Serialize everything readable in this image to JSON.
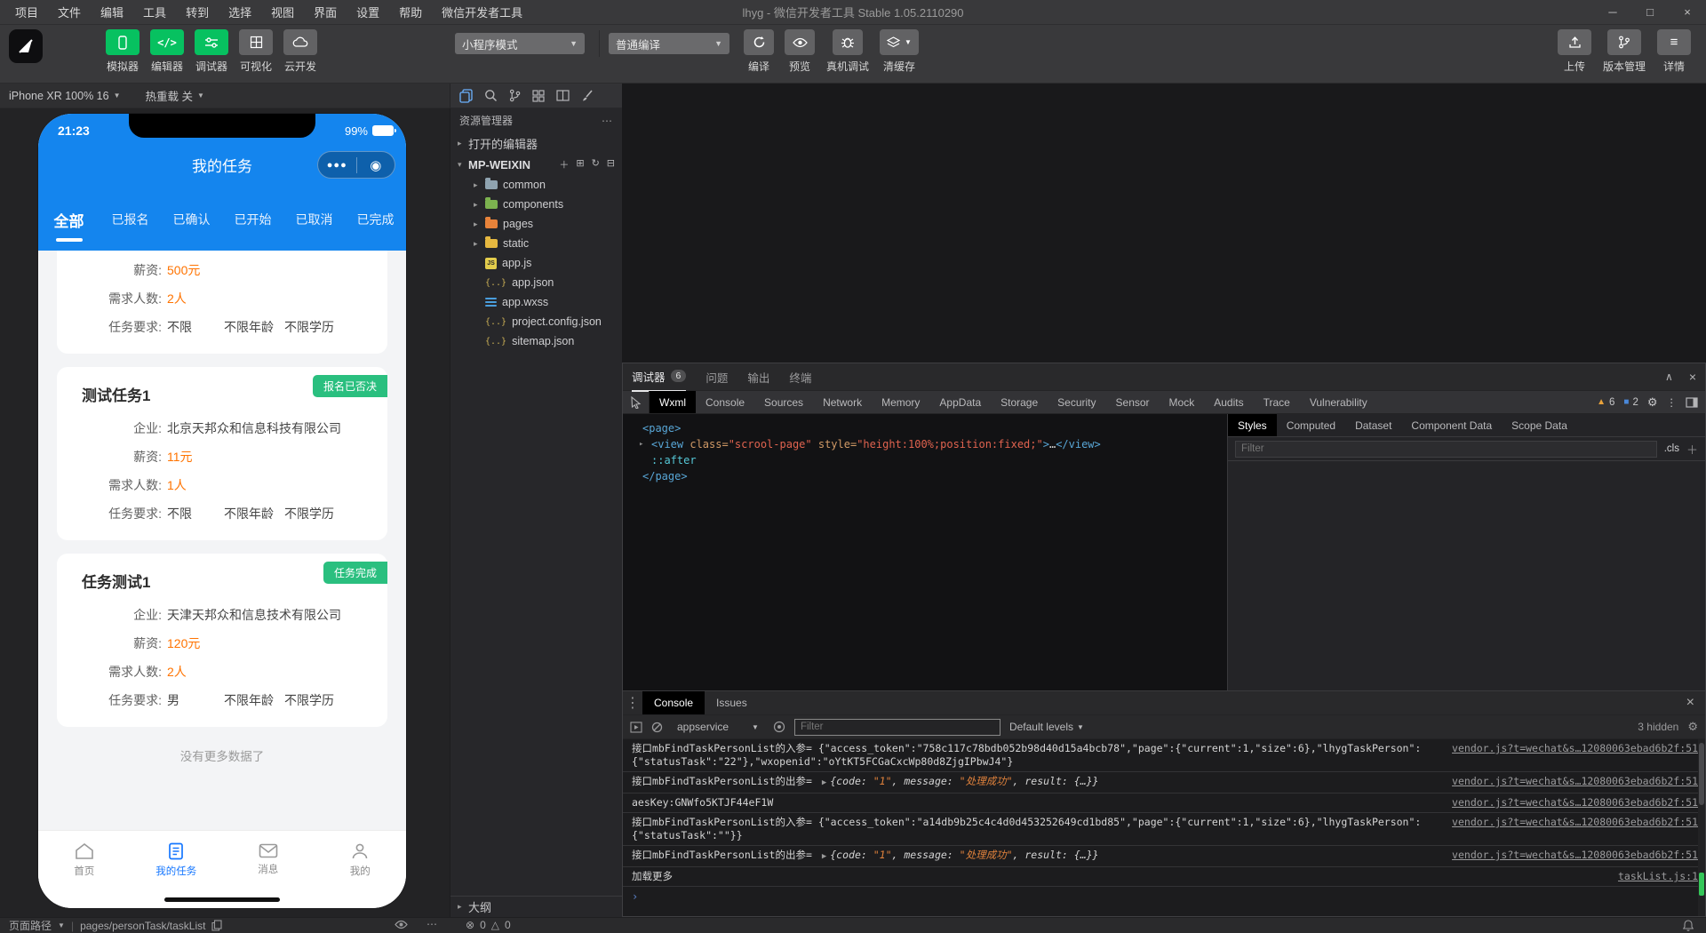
{
  "colors": {
    "brand_green": "#07c160",
    "phone_blue": "#1485ee",
    "highlight_orange": "#ff7300",
    "badge_green": "#2abf7f",
    "tab_active_blue": "#1677ff",
    "warning_yellow": "#e9a23b",
    "info_blue": "#4a88d9"
  },
  "titlebar": {
    "menus": [
      "项目",
      "文件",
      "编辑",
      "工具",
      "转到",
      "选择",
      "视图",
      "界面",
      "设置",
      "帮助",
      "微信开发者工具"
    ],
    "title": "lhyg - 微信开发者工具 Stable 1.05.2110290"
  },
  "toolbar": {
    "left_buttons": [
      {
        "label": "模拟器"
      },
      {
        "label": "编辑器"
      },
      {
        "label": "调试器"
      },
      {
        "label": "可视化"
      },
      {
        "label": "云开发"
      }
    ],
    "mode_select": "小程序模式",
    "compile_select": "普通编译",
    "action_buttons": [
      {
        "label": "编译"
      },
      {
        "label": "预览"
      },
      {
        "label": "真机调试"
      },
      {
        "label": "清缓存"
      }
    ],
    "right_buttons": [
      {
        "label": "上传"
      },
      {
        "label": "版本管理"
      },
      {
        "label": "详情"
      }
    ]
  },
  "simulator_bar": {
    "device": "iPhone XR 100% 16",
    "hot_reload": "热重载 关"
  },
  "phone": {
    "status": {
      "time": "21:23",
      "battery": "99%"
    },
    "nav_title": "我的任务",
    "tabs": [
      {
        "label": "全部",
        "active": true
      },
      {
        "label": "已报名"
      },
      {
        "label": "已确认"
      },
      {
        "label": "已开始"
      },
      {
        "label": "已取消"
      },
      {
        "label": "已完成"
      }
    ],
    "cards": [
      {
        "badge": null,
        "title": null,
        "rows": [
          {
            "label": "薪资:",
            "value": "500元",
            "hl": true
          },
          {
            "label": "需求人数:",
            "value": "2人",
            "hl": true
          },
          {
            "label": "任务要求:",
            "value": "不限",
            "extras": [
              "不限年龄",
              "不限学历"
            ]
          }
        ]
      },
      {
        "badge": "报名已否决",
        "title": "测试任务1",
        "rows": [
          {
            "label": "企业:",
            "value": "北京天邦众和信息科技有限公司"
          },
          {
            "label": "薪资:",
            "value": "11元",
            "hl": true
          },
          {
            "label": "需求人数:",
            "value": "1人",
            "hl": true
          },
          {
            "label": "任务要求:",
            "value": "不限",
            "extras": [
              "不限年龄",
              "不限学历"
            ]
          }
        ]
      },
      {
        "badge": "任务完成",
        "title": "任务测试1",
        "rows": [
          {
            "label": "企业:",
            "value": "天津天邦众和信息技术有限公司"
          },
          {
            "label": "薪资:",
            "value": "120元",
            "hl": true
          },
          {
            "label": "需求人数:",
            "value": "2人",
            "hl": true
          },
          {
            "label": "任务要求:",
            "value": "男",
            "extras": [
              "不限年龄",
              "不限学历"
            ]
          }
        ]
      }
    ],
    "empty_text": "没有更多数据了",
    "tabbar": [
      {
        "label": "首页"
      },
      {
        "label": "我的任务",
        "active": true
      },
      {
        "label": "消息"
      },
      {
        "label": "我的"
      }
    ]
  },
  "explorer": {
    "header": "资源管理器",
    "open_editors": "打开的编辑器",
    "project": "MP-WEIXIN",
    "tree": [
      {
        "name": "common",
        "icon": "folder",
        "color": "#8fa3b0"
      },
      {
        "name": "components",
        "icon": "folder",
        "color": "#7cb24f"
      },
      {
        "name": "pages",
        "icon": "folder",
        "color": "#e8833a"
      },
      {
        "name": "static",
        "icon": "folder",
        "color": "#e6b840"
      },
      {
        "name": "app.js",
        "icon": "js"
      },
      {
        "name": "app.json",
        "icon": "braces"
      },
      {
        "name": "app.wxss",
        "icon": "wxss"
      },
      {
        "name": "project.config.json",
        "icon": "braces"
      },
      {
        "name": "sitemap.json",
        "icon": "braces"
      }
    ],
    "outline": "大纲"
  },
  "debugger": {
    "panel_tabs": [
      {
        "label": "调试器",
        "badge": "6",
        "active": true
      },
      {
        "label": "问题"
      },
      {
        "label": "输出"
      },
      {
        "label": "终端"
      }
    ],
    "devtools_tabs": [
      "Wxml",
      "Console",
      "Sources",
      "Network",
      "Memory",
      "AppData",
      "Storage",
      "Security",
      "Sensor",
      "Mock",
      "Audits",
      "Trace",
      "Vulnerability"
    ],
    "active_devtools_tab": "Wxml",
    "warn_count": "6",
    "info_count": "2",
    "code_lines": [
      {
        "indent": 0,
        "parts": [
          [
            "tag",
            "<page>"
          ]
        ]
      },
      {
        "indent": 1,
        "arrow": true,
        "parts": [
          [
            "tag",
            "<view"
          ],
          [
            "attr",
            " class="
          ],
          [
            "str",
            "\"scrool-page\""
          ],
          [
            "attr",
            " style="
          ],
          [
            "str",
            "\"height:100%;position:fixed;\""
          ],
          [
            "tag",
            ">"
          ],
          [
            "t",
            "…"
          ],
          [
            "tag",
            "</view>"
          ]
        ]
      },
      {
        "indent": 1,
        "parts": [
          [
            "pseudo",
            "::after"
          ]
        ]
      },
      {
        "indent": 0,
        "parts": [
          [
            "tag",
            "</page>"
          ]
        ]
      }
    ],
    "styles_tabs": [
      "Styles",
      "Computed",
      "Dataset",
      "Component Data",
      "Scope Data"
    ],
    "active_styles_tab": "Styles",
    "filter_placeholder": "Filter",
    "cls_label": ".cls"
  },
  "console": {
    "tabs": [
      "Console",
      "Issues"
    ],
    "active_tab": "Console",
    "context": "appservice",
    "filter_placeholder": "Filter",
    "levels": "Default levels",
    "hidden": "3 hidden",
    "logs": [
      {
        "parts": [
          [
            "t",
            "接口mbFindTaskPersonList的入参= {\"access_token\":\"758c117c78bdb052b98d40d15a4bcb78\",\"page\":{\"current\":1,\"size\":6},\"lhygTaskPerson\":{\"statusTask\":\"22\"},\"wxopenid\":\"oYtKT5FCGaCxcWp80d8ZjgIPbwJ4\"}"
          ]
        ],
        "link": "vendor.js?t=wechat&s…12080063ebad6b2f:51"
      },
      {
        "parts": [
          [
            "t",
            "接口mbFindTaskPersonList的出参= "
          ],
          [
            "a",
            "▶"
          ],
          [
            "o",
            "{code: "
          ],
          [
            "s",
            "\"1\""
          ],
          [
            "o",
            ", message: "
          ],
          [
            "s",
            "\"处理成功\""
          ],
          [
            "o",
            ", result: {…}}"
          ]
        ],
        "link": "vendor.js?t=wechat&s…12080063ebad6b2f:51"
      },
      {
        "parts": [
          [
            "t",
            "aesKey:GNWfo5KTJF44eF1W"
          ]
        ],
        "link": "vendor.js?t=wechat&s…12080063ebad6b2f:51"
      },
      {
        "parts": [
          [
            "t",
            "接口mbFindTaskPersonList的入参= {\"access_token\":\"a14db9b25c4c4d0d453252649cd1bd85\",\"page\":{\"current\":1,\"size\":6},\"lhygTaskPerson\":{\"statusTask\":\"\"}}"
          ]
        ],
        "link": "vendor.js?t=wechat&s…12080063ebad6b2f:51"
      },
      {
        "parts": [
          [
            "t",
            "接口mbFindTaskPersonList的出参= "
          ],
          [
            "a",
            "▶"
          ],
          [
            "o",
            "{code: "
          ],
          [
            "s",
            "\"1\""
          ],
          [
            "o",
            ", message: "
          ],
          [
            "s",
            "\"处理成功\""
          ],
          [
            "o",
            ", result: {…}}"
          ]
        ],
        "link": "vendor.js?t=wechat&s…12080063ebad6b2f:51"
      },
      {
        "parts": [
          [
            "t",
            "加载更多"
          ]
        ],
        "link": "taskList.js:1"
      }
    ]
  },
  "statusbar": {
    "page_path_label": "页面路径",
    "page_path": "pages/personTask/taskList",
    "errors": "0",
    "warnings": "0"
  }
}
